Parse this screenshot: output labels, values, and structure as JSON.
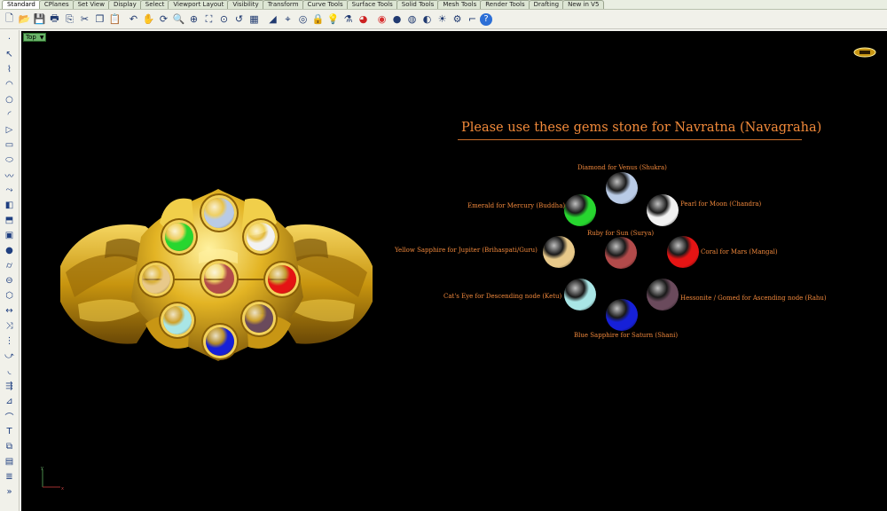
{
  "tabs": [
    "Standard",
    "CPlanes",
    "Set View",
    "Display",
    "Select",
    "Viewport Layout",
    "Visibility",
    "Transform",
    "Curve Tools",
    "Surface Tools",
    "Solid Tools",
    "Mesh Tools",
    "Render Tools",
    "Drafting",
    "New in V5"
  ],
  "toolbar_icons": [
    "new-icon",
    "open-icon",
    "save-icon",
    "print-icon",
    "import-icon",
    "cut-icon",
    "copy-icon",
    "paste-icon",
    "undo-icon",
    "pan-icon",
    "rotate-view-icon",
    "zoom-window-icon",
    "zoom-dynamic-icon",
    "zoom-extents-icon",
    "zoom-selected-icon",
    "undo-view-icon",
    "four-viewports-icon",
    "construction-plane-icon",
    "grid-snap-icon",
    "cplane-icon",
    "lock-icon",
    "light-icon",
    "dropper-icon",
    "render-icon",
    "color-wheel-icon",
    "material-sphere-icon",
    "shade-sphere-icon",
    "environment-icon",
    "properties-icon",
    "options-gear-icon",
    "layout-icon",
    "help-icon"
  ],
  "left_icons": [
    "point-icon",
    "select-icon",
    "polyline-icon",
    "curve-icon",
    "circle-icon",
    "arc-icon",
    "triangle-icon",
    "rectangle-icon",
    "ellipse-icon",
    "freeform-icon",
    "curve-tools-icon",
    "surface-icon",
    "extrude-icon",
    "solid-box-icon",
    "sphere-icon",
    "cylinder-icon",
    "boolean-icon",
    "mesh-icon",
    "dimension-icon",
    "transform-icon",
    "array-icon",
    "bend-icon",
    "fillet-icon",
    "offset-icon",
    "analyze-icon",
    "render-pipe-icon",
    "text-icon",
    "group-icon",
    "block-icon",
    "layer-icon",
    "more-icon"
  ],
  "viewport": {
    "label": "Top",
    "title": "Please use these gems stone for Navratna (Navagraha)"
  },
  "gems": {
    "diamond": {
      "label": "Diamond for Venus (Shukra)",
      "color": "#b9cbe6"
    },
    "pearl": {
      "label": "Pearl for Moon (Chandra)",
      "color": "#f2f2f2"
    },
    "emerald": {
      "label": "Emerald for Mercury (Buddha)",
      "color": "#27d62f"
    },
    "ruby": {
      "label": "Ruby for Sun (Surya)",
      "color": "#b24a4a"
    },
    "yellow_sapphire": {
      "label": "Yellow Sapphire for Jupiter (Brihaspati/Guru)",
      "color": "#e8c98a"
    },
    "coral": {
      "label": "Coral for Mars (Mangal)",
      "color": "#e51414"
    },
    "cats_eye": {
      "label": "Cat's Eye for Descending node (Ketu)",
      "color": "#a9e6e6"
    },
    "hessonite": {
      "label": "Hessonite / Gomed for Ascending node (Rahu)",
      "color": "#6a4a5c"
    },
    "blue_sapphire": {
      "label": "Blue Sapphire for Saturn (Shani)",
      "color": "#1620d8"
    }
  },
  "colors": {
    "gold": "#d8a81a",
    "label_orange": "#f0883c",
    "background": "#000000"
  }
}
